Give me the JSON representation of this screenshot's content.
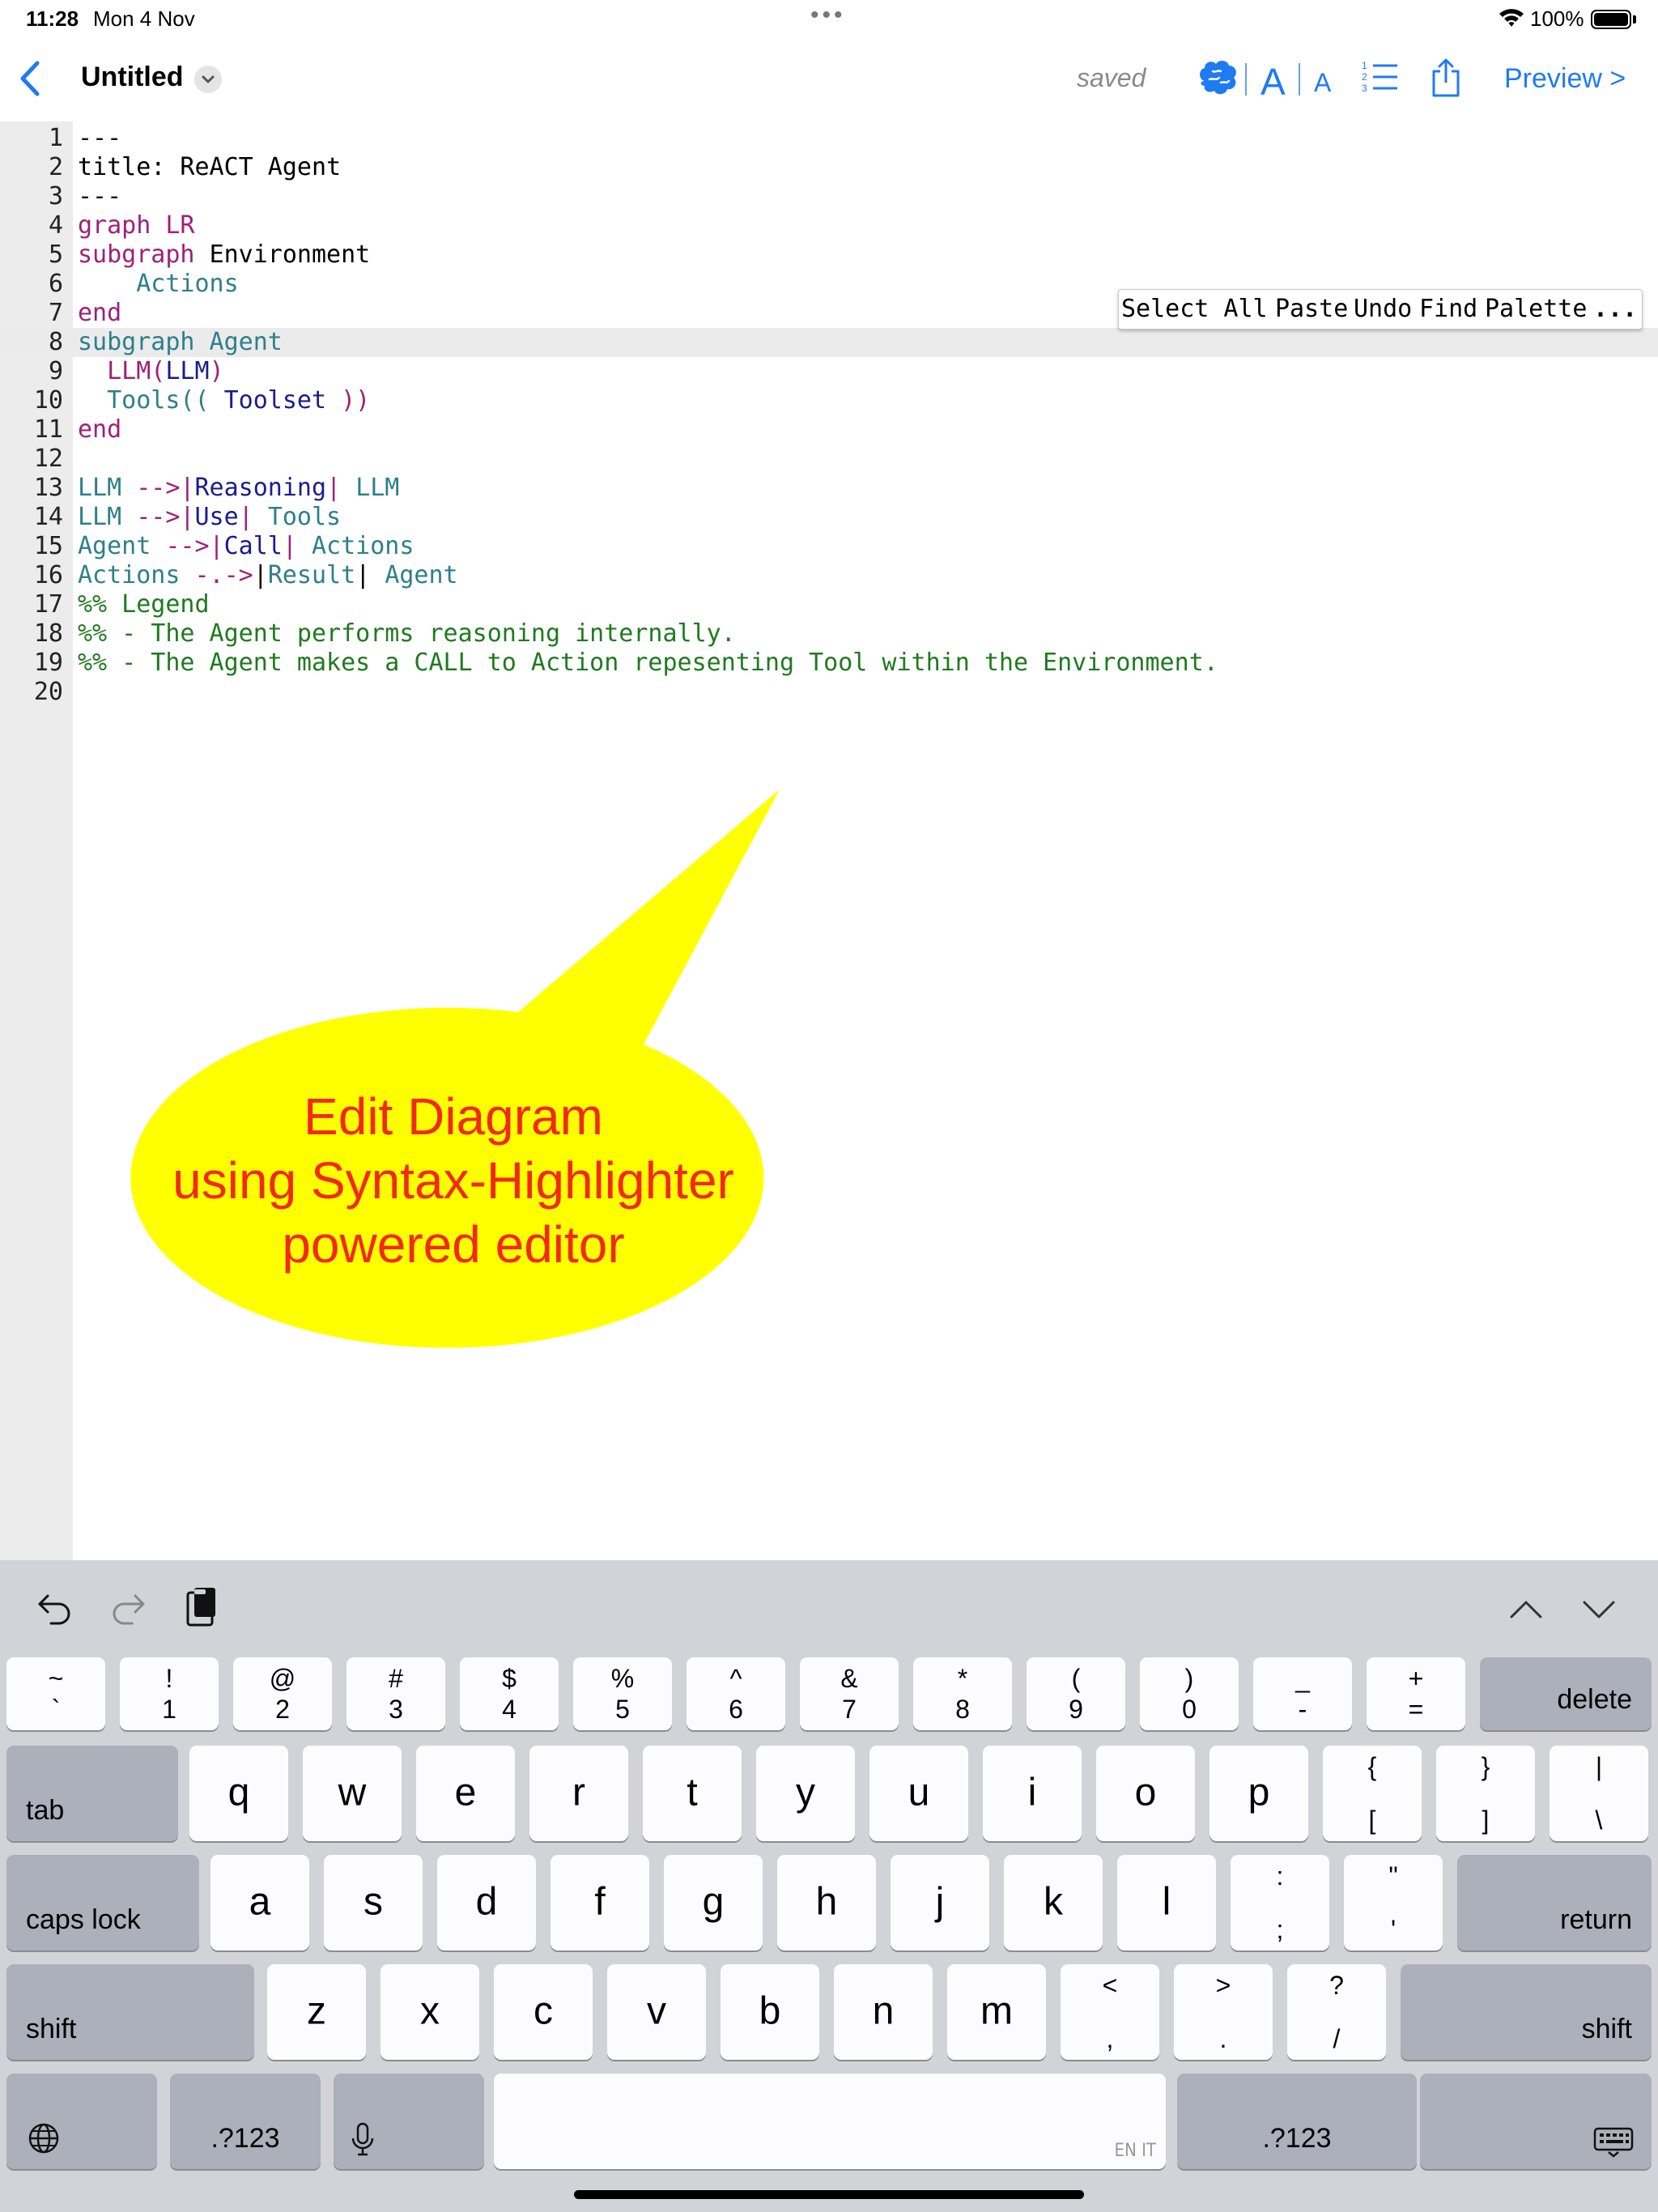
{
  "status_bar": {
    "time": "11:28",
    "date": "Mon 4 Nov",
    "battery": "100%"
  },
  "nav": {
    "title": "Untitled",
    "save_state": "saved",
    "font_large": "A",
    "font_small": "A",
    "preview": "Preview >",
    "icons": [
      "chevron-left-icon",
      "chevron-down-icon",
      "brain-icon",
      "list-numbered-icon",
      "share-icon"
    ]
  },
  "editor": {
    "line_numbers": [
      "1",
      "2",
      "3",
      "4",
      "5",
      "6",
      "7",
      "8",
      "9",
      "10",
      "11",
      "12",
      "13",
      "14",
      "15",
      "16",
      "17",
      "18",
      "19",
      "20"
    ],
    "code": [
      [
        {
          "t": "---",
          "c": "plain"
        }
      ],
      [
        {
          "t": "title: ReACT Agent",
          "c": "black"
        }
      ],
      [
        {
          "t": "---",
          "c": "plain"
        }
      ],
      [
        {
          "t": "graph LR",
          "c": "key"
        }
      ],
      [
        {
          "t": "subgraph ",
          "c": "key"
        },
        {
          "t": "Environment",
          "c": "black"
        }
      ],
      [
        {
          "t": "    Actions",
          "c": "teal"
        }
      ],
      [
        {
          "t": "end",
          "c": "key"
        }
      ],
      [
        {
          "t": "subgraph Agent",
          "c": "teal"
        }
      ],
      [
        {
          "t": "  LLM(",
          "c": "key"
        },
        {
          "t": "LLM",
          "c": "navy"
        },
        {
          "t": ")",
          "c": "key"
        }
      ],
      [
        {
          "t": "  Tools(( ",
          "c": "teal"
        },
        {
          "t": "Toolset",
          "c": "navy"
        },
        {
          "t": " ))",
          "c": "key"
        }
      ],
      [
        {
          "t": "end",
          "c": "key"
        }
      ],
      [],
      [
        {
          "t": "LLM ",
          "c": "teal"
        },
        {
          "t": "-->|",
          "c": "key"
        },
        {
          "t": "Reasoning",
          "c": "navy"
        },
        {
          "t": "| ",
          "c": "key"
        },
        {
          "t": "LLM",
          "c": "teal"
        }
      ],
      [
        {
          "t": "LLM ",
          "c": "teal"
        },
        {
          "t": "-->|",
          "c": "key"
        },
        {
          "t": "Use",
          "c": "navy"
        },
        {
          "t": "| ",
          "c": "key"
        },
        {
          "t": "Tools",
          "c": "teal"
        }
      ],
      [
        {
          "t": "Agent ",
          "c": "teal"
        },
        {
          "t": "-->|",
          "c": "key"
        },
        {
          "t": "Call",
          "c": "navy"
        },
        {
          "t": "| ",
          "c": "key"
        },
        {
          "t": "Actions",
          "c": "teal"
        }
      ],
      [
        {
          "t": "Actions ",
          "c": "teal"
        },
        {
          "t": "-.->",
          "c": "key"
        },
        {
          "t": "|",
          "c": "black"
        },
        {
          "t": "Result",
          "c": "teal"
        },
        {
          "t": "| ",
          "c": "black"
        },
        {
          "t": "Agent",
          "c": "teal"
        }
      ],
      [
        {
          "t": "%% Legend",
          "c": "cmt"
        }
      ],
      [
        {
          "t": "%% - The Agent performs reasoning internally.",
          "c": "cmt"
        }
      ],
      [
        {
          "t": "%% - The Agent makes a CALL to Action repesenting Tool within the Environment.",
          "c": "cmt"
        }
      ],
      []
    ],
    "active_line": 8
  },
  "context_menu": {
    "items": [
      "Select All",
      "Paste",
      "Undo",
      "Find",
      "Palette",
      "..."
    ]
  },
  "callout": {
    "lines": [
      "Edit Diagram",
      "using Syntax-Highlighter",
      "powered editor"
    ],
    "fill_color": "#ffff00",
    "text_color": "#f22a12"
  },
  "keyboard": {
    "toolbar_icons": [
      "undo-icon",
      "redo-icon",
      "clipboard-icon",
      "chevron-up-icon",
      "chevron-down-icon"
    ],
    "row1": [
      {
        "top": "~",
        "bot": "`"
      },
      {
        "top": "!",
        "bot": "1"
      },
      {
        "top": "@",
        "bot": "2"
      },
      {
        "top": "#",
        "bot": "3"
      },
      {
        "top": "$",
        "bot": "4"
      },
      {
        "top": "%",
        "bot": "5"
      },
      {
        "top": "^",
        "bot": "6"
      },
      {
        "top": "&",
        "bot": "7"
      },
      {
        "top": "*",
        "bot": "8"
      },
      {
        "top": "(",
        "bot": "9"
      },
      {
        "top": ")",
        "bot": "0"
      },
      {
        "top": "_",
        "bot": "-"
      },
      {
        "top": "+",
        "bot": "="
      }
    ],
    "delete": "delete",
    "tab": "tab",
    "row2": [
      "q",
      "w",
      "e",
      "r",
      "t",
      "y",
      "u",
      "i",
      "o",
      "p"
    ],
    "row2_sym": [
      {
        "top": "{",
        "bot": "["
      },
      {
        "top": "}",
        "bot": "]"
      },
      {
        "top": "|",
        "bot": "\\"
      }
    ],
    "caps_lock": "caps lock",
    "row3": [
      "a",
      "s",
      "d",
      "f",
      "g",
      "h",
      "j",
      "k",
      "l"
    ],
    "row3_sym": [
      {
        "top": ":",
        "bot": ";"
      },
      {
        "top": "\"",
        "bot": "'"
      }
    ],
    "return": "return",
    "shift": "shift",
    "row4": [
      "z",
      "x",
      "c",
      "v",
      "b",
      "n",
      "m"
    ],
    "row4_sym": [
      {
        "top": "<",
        "bot": ","
      },
      {
        "top": ">",
        "bot": "."
      },
      {
        "top": "?",
        "bot": "/"
      }
    ],
    "numbers": ".?123",
    "space_hint": "EN IT"
  }
}
